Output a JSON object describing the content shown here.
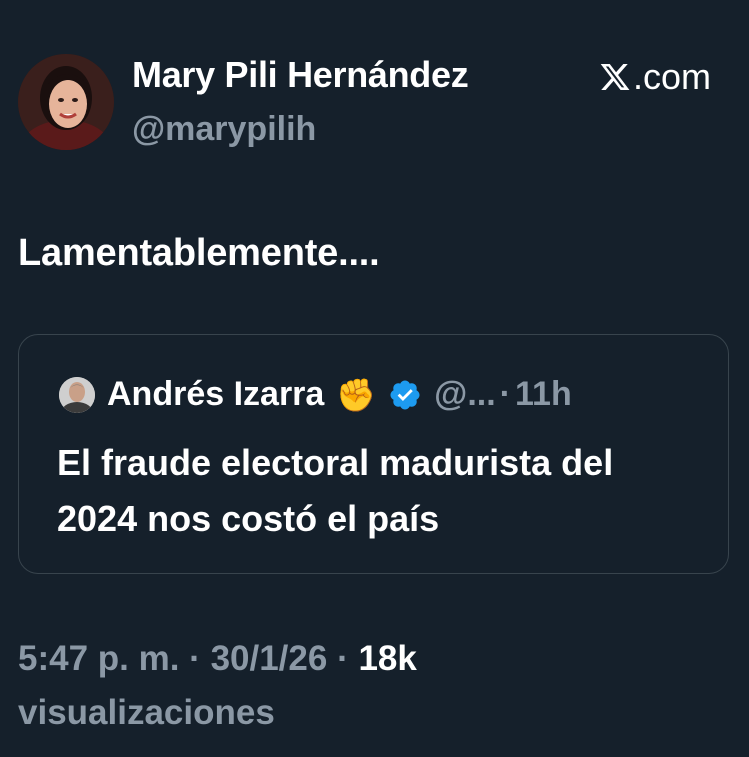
{
  "author": {
    "display_name": "Mary Pili Hernández",
    "handle": "@marypilih"
  },
  "brand": {
    "icon": "x-logo-icon",
    "domain": ".com"
  },
  "tweet": {
    "text": "Lamentablemente...."
  },
  "quoted_tweet": {
    "display_name": "Andrés Izarra",
    "emoji": "✊",
    "verified_icon": "verified-badge-icon",
    "handle_truncated": "@...",
    "separator": "·",
    "time_ago": "11h",
    "text": "El fraude electoral madurista del 2024 nos costó el país"
  },
  "footer": {
    "time": "5:47 p. m.",
    "sep1": " · ",
    "date": "30/1/26",
    "sep2": " · ",
    "views_count": "18k",
    "views_label": "visualizaciones"
  },
  "colors": {
    "background": "#15202b",
    "text_primary": "#ffffff",
    "text_secondary": "#8b98a5",
    "border": "#38444d",
    "verified": "#1d9bf0"
  }
}
